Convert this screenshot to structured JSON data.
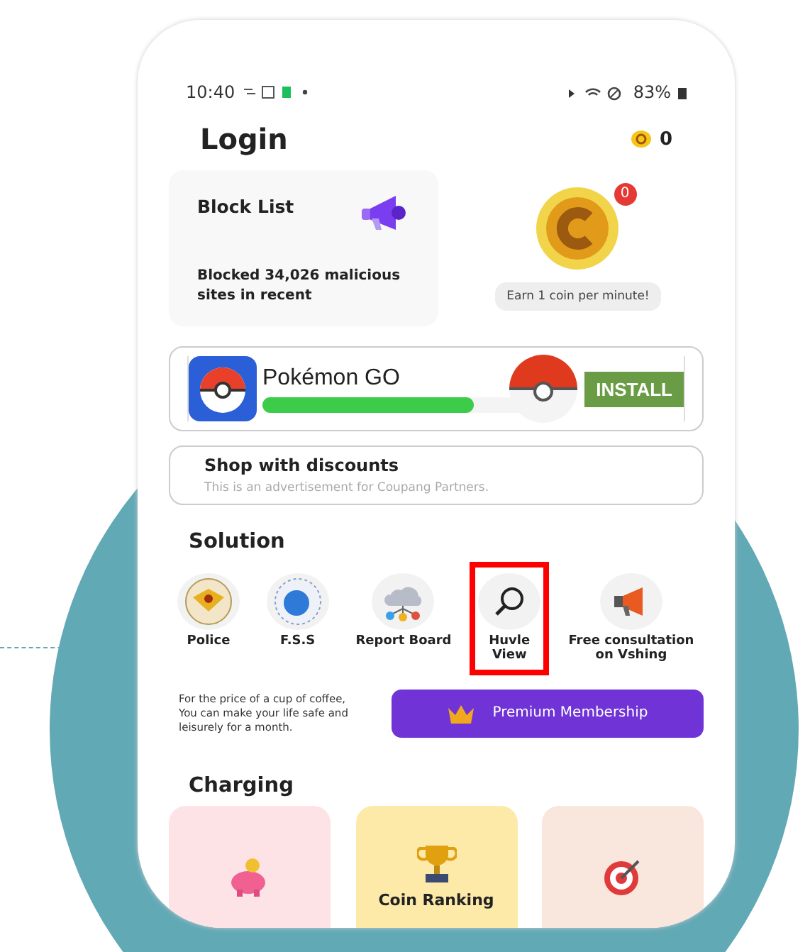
{
  "status_bar": {
    "time": "10:40",
    "battery": "83%"
  },
  "header": {
    "title": "Login",
    "coin_count": "0"
  },
  "block_card": {
    "title": "Block List",
    "text": "Blocked 34,026 malicious sites in recent"
  },
  "coin_card": {
    "badge": "0",
    "caption": "Earn 1 coin per minute!"
  },
  "ad": {
    "app_name": "Pokémon GO",
    "button": "INSTALL",
    "level": 0.75
  },
  "shop": {
    "title": "Shop with discounts",
    "subtitle": "This is an advertisement for Coupang Partners."
  },
  "solution": {
    "title": "Solution",
    "items": [
      {
        "label": "Police",
        "kind": "badge",
        "highlighted": false
      },
      {
        "label": "F.S.S",
        "kind": "globe",
        "highlighted": false
      },
      {
        "label": "Report Board",
        "kind": "cloud",
        "highlighted": false
      },
      {
        "label": "Huvle View",
        "kind": "search",
        "highlighted": true
      },
      {
        "label": "Free consultation on Vshing",
        "kind": "megaphone",
        "highlighted": false
      }
    ]
  },
  "premium": {
    "text": "For the price of a cup of coffee, You can make your life safe and leisurely for a month.",
    "button": "Premium Membership"
  },
  "charging": {
    "title": "Charging",
    "cards": [
      {
        "kind": "piggy",
        "color": "#fde3e6"
      },
      {
        "kind": "trophy",
        "label": "Coin Ranking",
        "color": "#fde9a8"
      },
      {
        "kind": "target",
        "color": "#f9e6dc"
      }
    ]
  }
}
